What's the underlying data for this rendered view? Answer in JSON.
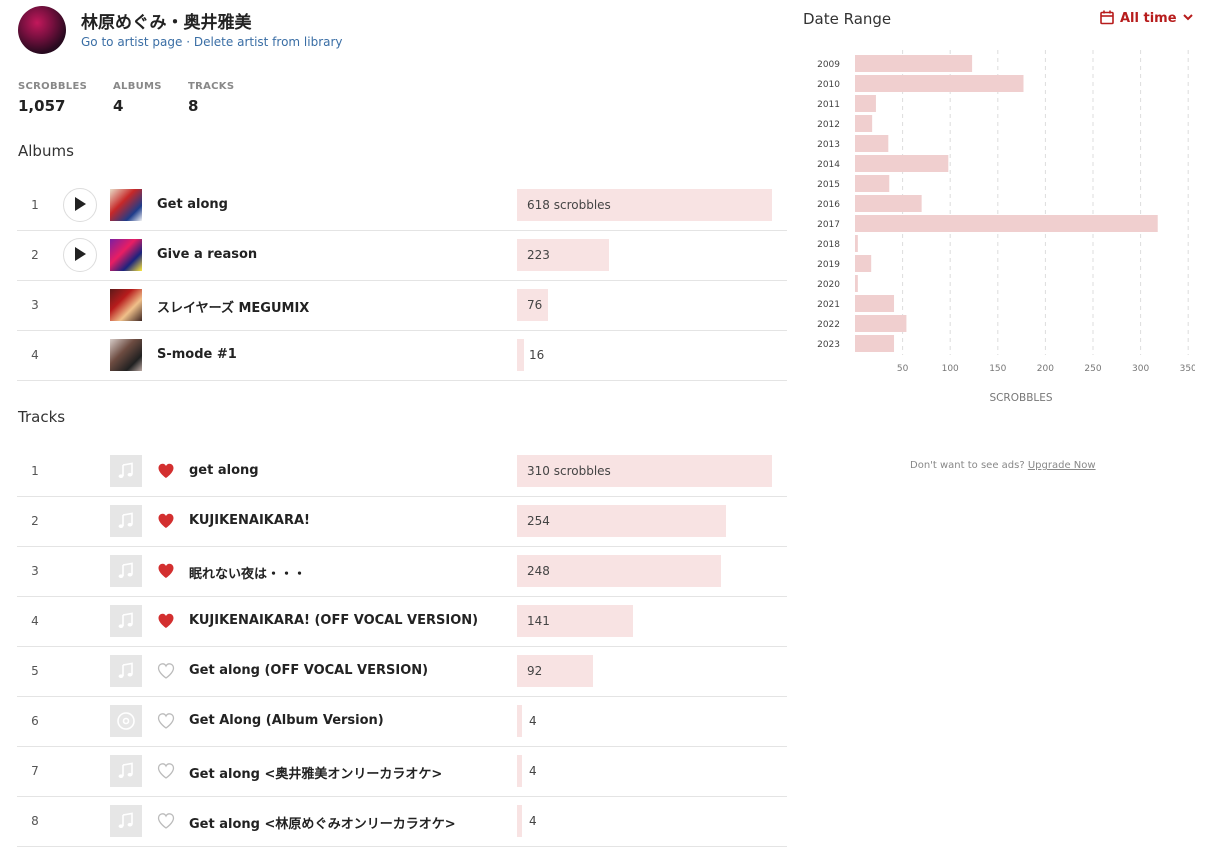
{
  "artist": {
    "name": "林原めぐみ・奥井雅美",
    "go_to_page": "Go to artist page",
    "separator": " · ",
    "delete": "Delete artist from library"
  },
  "stats": [
    {
      "label": "SCROBBLES",
      "value": "1,057"
    },
    {
      "label": "ALBUMS",
      "value": "4"
    },
    {
      "label": "TRACKS",
      "value": "8"
    }
  ],
  "albums_title": "Albums",
  "albums": [
    {
      "rank": "1",
      "title": "Get along",
      "scrobbles": 618,
      "label": "618 scrobbles",
      "playable": true
    },
    {
      "rank": "2",
      "title": "Give a reason",
      "scrobbles": 223,
      "label": "223",
      "playable": true
    },
    {
      "rank": "3",
      "title": "スレイヤーズ MEGUMIX",
      "scrobbles": 76,
      "label": "76",
      "playable": false
    },
    {
      "rank": "4",
      "title": "S-mode #1",
      "scrobbles": 16,
      "label": "16",
      "playable": false
    }
  ],
  "tracks_title": "Tracks",
  "tracks": [
    {
      "rank": "1",
      "title": "get along",
      "scrobbles": 310,
      "label": "310 scrobbles",
      "loved": true,
      "icon": "music-note-icon"
    },
    {
      "rank": "2",
      "title": "KUJIKENAIKARA!",
      "scrobbles": 254,
      "label": "254",
      "loved": true,
      "icon": "music-note-icon"
    },
    {
      "rank": "3",
      "title": "眠れない夜は・・・",
      "scrobbles": 248,
      "label": "248",
      "loved": true,
      "icon": "music-note-icon"
    },
    {
      "rank": "4",
      "title": "KUJIKENAIKARA! (OFF VOCAL VERSION)",
      "scrobbles": 141,
      "label": "141",
      "loved": true,
      "icon": "music-note-icon"
    },
    {
      "rank": "5",
      "title": "Get along (OFF VOCAL VERSION)",
      "scrobbles": 92,
      "label": "92",
      "loved": false,
      "icon": "music-note-icon"
    },
    {
      "rank": "6",
      "title": "Get Along (Album Version)",
      "scrobbles": 4,
      "label": "4",
      "loved": false,
      "icon": "disc-icon"
    },
    {
      "rank": "7",
      "title": "Get along <奥井雅美オンリーカラオケ>",
      "scrobbles": 4,
      "label": "4",
      "loved": false,
      "icon": "music-note-icon"
    },
    {
      "rank": "8",
      "title": "Get along <林原めぐみオンリーカラオケ>",
      "scrobbles": 4,
      "label": "4",
      "loved": false,
      "icon": "music-note-icon"
    }
  ],
  "date_range": {
    "title": "Date Range",
    "selected": "All time"
  },
  "chart_data": {
    "type": "bar",
    "orientation": "horizontal",
    "categories": [
      "2009",
      "2010",
      "2011",
      "2012",
      "2013",
      "2014",
      "2015",
      "2016",
      "2017",
      "2018",
      "2019",
      "2020",
      "2021",
      "2022",
      "2023"
    ],
    "values": [
      123,
      177,
      22,
      18,
      35,
      98,
      36,
      70,
      318,
      3,
      17,
      3,
      41,
      54,
      41
    ],
    "xlabel": "SCROBBLES",
    "ylabel": "",
    "xticks": [
      50,
      100,
      150,
      200,
      250,
      300,
      350
    ],
    "xlim": [
      0,
      350
    ],
    "grid": true,
    "bar_color": "#f0cfcf"
  },
  "ads": {
    "text": "Don't want to see ads?",
    "link": "Upgrade Now"
  },
  "colors": {
    "accent": "#b71c1c",
    "heart": "#d32f2f",
    "bar": "#f8e3e3",
    "link": "#3a6ea5"
  }
}
